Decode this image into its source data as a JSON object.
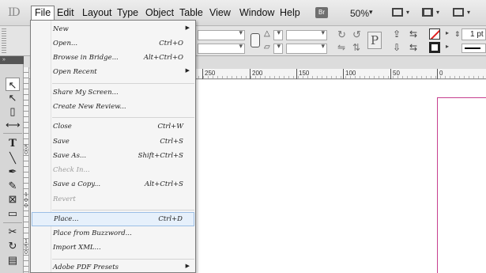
{
  "menubar": {
    "app_logo": "ID",
    "items": [
      "File",
      "Edit",
      "Layout",
      "Type",
      "Object",
      "Table",
      "View",
      "Window",
      "Help"
    ],
    "bridge_label": "Br",
    "zoom": "50%",
    "zoom_arrow": "▾"
  },
  "control_panel": {
    "stroke_weight": "1 pt",
    "type_glyph": "P"
  },
  "tools": {
    "header": "»",
    "items": [
      {
        "name": "selection-tool",
        "glyph": "↖",
        "selected": true
      },
      {
        "name": "direct-selection-tool",
        "glyph": "↖",
        "selected": false
      },
      {
        "name": "page-tool",
        "glyph": "▯",
        "selected": false
      },
      {
        "name": "gap-tool",
        "glyph": "⟷",
        "selected": false
      },
      {
        "name": "type-tool",
        "glyph": "T",
        "selected": false
      },
      {
        "name": "line-tool",
        "glyph": "╲",
        "selected": false
      },
      {
        "name": "pen-tool",
        "glyph": "✒",
        "selected": false
      },
      {
        "name": "pencil-tool",
        "glyph": "✎",
        "selected": false
      },
      {
        "name": "rectangle-frame-tool",
        "glyph": "⊠",
        "selected": false
      },
      {
        "name": "rectangle-tool",
        "glyph": "▭",
        "selected": false
      },
      {
        "name": "scissors-tool",
        "glyph": "✂",
        "selected": false
      },
      {
        "name": "free-transform-tool",
        "glyph": "↻",
        "selected": false
      },
      {
        "name": "gradient-tool",
        "glyph": "▤",
        "selected": false
      }
    ]
  },
  "ruler": {
    "horizontal": [
      "250",
      "200",
      "150",
      "100",
      "50",
      "0"
    ],
    "vertical": [
      "50",
      "100",
      "150"
    ]
  },
  "file_menu": {
    "items": [
      {
        "label": "New",
        "shortcut": "",
        "submenu": true,
        "disabled": false
      },
      {
        "label": "Open...",
        "shortcut": "Ctrl+O",
        "submenu": false,
        "disabled": false
      },
      {
        "label": "Browse in Bridge...",
        "shortcut": "Alt+Ctrl+O",
        "submenu": false,
        "disabled": false
      },
      {
        "label": "Open Recent",
        "shortcut": "",
        "submenu": true,
        "disabled": false
      },
      {
        "label": "Share My Screen...",
        "shortcut": "",
        "submenu": false,
        "disabled": false
      },
      {
        "label": "Create New Review...",
        "shortcut": "",
        "submenu": false,
        "disabled": false
      },
      {
        "label": "Close",
        "shortcut": "Ctrl+W",
        "submenu": false,
        "disabled": false
      },
      {
        "label": "Save",
        "shortcut": "Ctrl+S",
        "submenu": false,
        "disabled": false
      },
      {
        "label": "Save As...",
        "shortcut": "Shift+Ctrl+S",
        "submenu": false,
        "disabled": false
      },
      {
        "label": "Check In...",
        "shortcut": "",
        "submenu": false,
        "disabled": true
      },
      {
        "label": "Save a Copy...",
        "shortcut": "Alt+Ctrl+S",
        "submenu": false,
        "disabled": false
      },
      {
        "label": "Revert",
        "shortcut": "",
        "submenu": false,
        "disabled": true
      },
      {
        "label": "Place...",
        "shortcut": "Ctrl+D",
        "submenu": false,
        "disabled": false,
        "hover": true
      },
      {
        "label": "Place from Buzzword...",
        "shortcut": "",
        "submenu": false,
        "disabled": false
      },
      {
        "label": "Import XML...",
        "shortcut": "",
        "submenu": false,
        "disabled": false
      },
      {
        "label": "Adobe PDF Presets",
        "shortcut": "",
        "submenu": true,
        "disabled": false
      }
    ]
  }
}
